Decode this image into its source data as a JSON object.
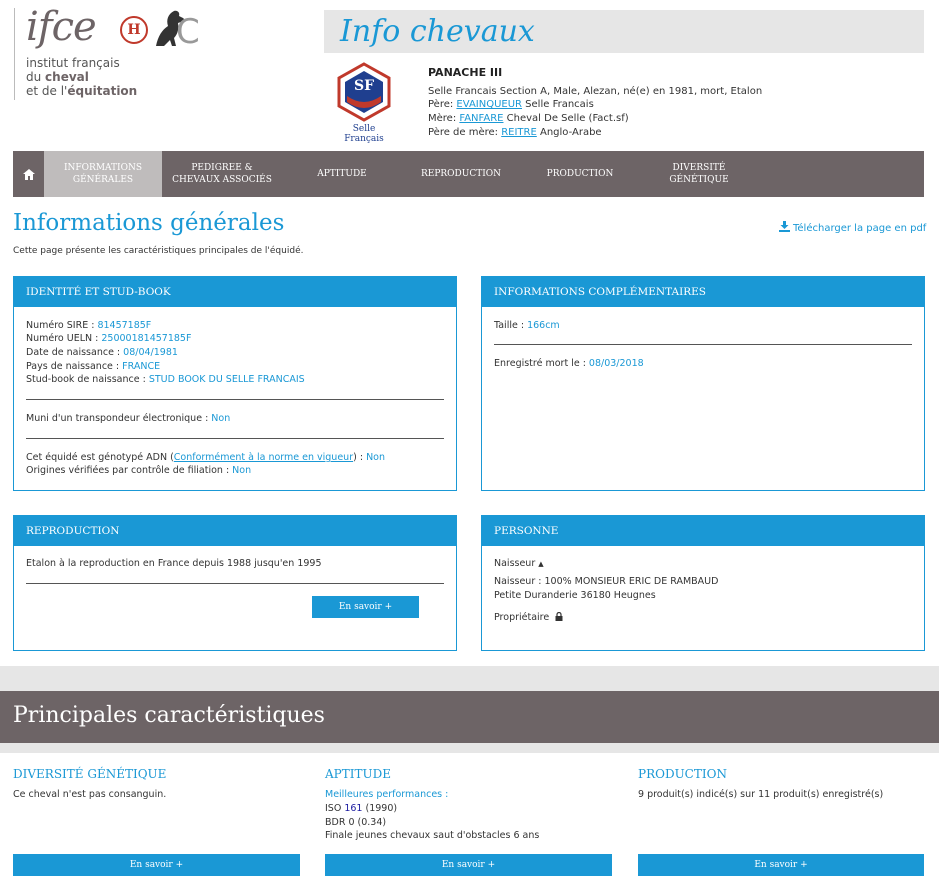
{
  "brand": {
    "logo_text": "ifce",
    "tagline_line1": "institut français",
    "tagline_line2_pre": "du ",
    "tagline_line2_bold": "cheval",
    "tagline_line3_pre": "et de l'",
    "tagline_line3_bold": "équitation",
    "seal_text": "H",
    "seal_c": "C"
  },
  "banner_title": "Info chevaux",
  "studbook_logo": {
    "initials": "SF",
    "label": "Selle Français"
  },
  "horse": {
    "name": "PANACHE III",
    "description": "Selle Francais Section A, Male, Alezan, né(e) en 1981, mort, Etalon",
    "sire_label": "Père: ",
    "sire_name": "EVAINQUEUR",
    "sire_breed": " Selle Francais",
    "dam_label": "Mère: ",
    "dam_name": "FANFARE",
    "dam_breed": " Cheval De Selle (Fact.sf)",
    "damsire_label": "Père de mère: ",
    "damsire_name": "REITRE",
    "damsire_breed": " Anglo-Arabe"
  },
  "nav": {
    "home_icon": "home-icon",
    "items": [
      {
        "line1": "Informations",
        "line2": "générales"
      },
      {
        "line1": "Pedigree &",
        "line2": "chevaux associés"
      },
      {
        "line1": "Aptitude",
        "line2": ""
      },
      {
        "line1": "Reproduction",
        "line2": ""
      },
      {
        "line1": "Production",
        "line2": ""
      },
      {
        "line1": "Diversité",
        "line2": "génétique"
      }
    ]
  },
  "page": {
    "title": "Informations générales",
    "subtitle": "Cette page présente les caractéristiques principales de l'équidé.",
    "pdf_label": "Télécharger la page en pdf",
    "pdf_icon": "download-icon"
  },
  "identity": {
    "title": "Identité et Stud-Book",
    "sire_label": "Numéro SIRE : ",
    "sire_value": "81457185F",
    "ueln_label": "Numéro UELN : ",
    "ueln_value": "25000181457185F",
    "birth_label": "Date de naissance : ",
    "birth_value": "08/04/1981",
    "country_label": "Pays de naissance : ",
    "country_value": "FRANCE",
    "studbook_label": "Stud-book de naissance : ",
    "studbook_value": "STUD BOOK DU SELLE FRANCAIS",
    "transponder_label": "Muni d'un transpondeur électronique : ",
    "transponder_value": "Non",
    "dna_label_pre": "Cet équidé est génotypé ADN (",
    "dna_link": "Conformément à la norme en vigueur",
    "dna_label_post": ") : ",
    "dna_value": "Non",
    "origins_label": "Origines vérifiées par contrôle de filiation : ",
    "origins_value": "Non"
  },
  "complementary": {
    "title": "Informations complémentaires",
    "height_label": "Taille : ",
    "height_value": "166cm",
    "death_label": "Enregistré mort le : ",
    "death_value": "08/03/2018"
  },
  "reproduction": {
    "title": "Reproduction",
    "text": "Etalon à la reproduction en France depuis 1988 jusqu'en 1995",
    "button": "En savoir +"
  },
  "person": {
    "title": "Personne",
    "breeder_toggle": "Naisseur",
    "breeder_line": "Naisseur : 100% MONSIEUR ERIC DE RAMBAUD",
    "breeder_address": "Petite Duranderie 36180 Heugnes",
    "owner_label": "Propriétaire",
    "owner_icon": "lock-icon"
  },
  "main_features": {
    "title": "Principales caractéristiques",
    "diversity": {
      "title": "Diversité génétique",
      "text": "Ce cheval n'est pas consanguin.",
      "button": "En savoir +"
    },
    "aptitude": {
      "title": "Aptitude",
      "best_label": "Meilleures performances :",
      "iso_pre": "ISO ",
      "iso_value": "161",
      "iso_year": " (1990)",
      "bdr": "BDR 0 (0.34)",
      "final": "Finale jeunes chevaux saut d'obstacles 6 ans",
      "button": "En savoir +"
    },
    "production": {
      "title": "Production",
      "text": "9 produit(s) indicé(s) sur 11 produit(s) enregistré(s)",
      "button": "En savoir +"
    }
  }
}
